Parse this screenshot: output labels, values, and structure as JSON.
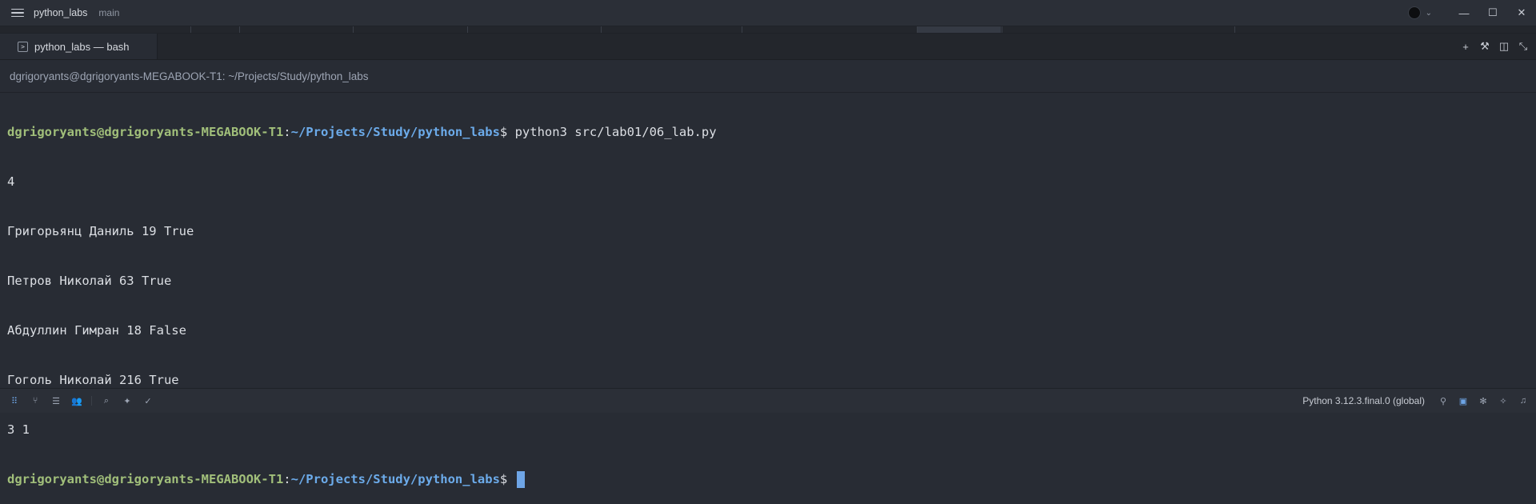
{
  "titlebar": {
    "project": "python_labs",
    "branch": "main"
  },
  "tab": {
    "label": "python_labs — bash",
    "icon": "terminal-icon"
  },
  "path_header": "dgrigoryants@dgrigoryants-MEGABOOK-T1: ~/Projects/Study/python_labs",
  "terminal": {
    "prompt_user": "dgrigoryants@dgrigoryants-MEGABOOK-T1",
    "prompt_colon": ":",
    "prompt_path": "~/Projects/Study/python_labs",
    "prompt_symbol": "$",
    "command": " python3 src/lab01/06_lab.py",
    "output": [
      "4",
      "Григорьянц Даниль 19 True",
      "Петров Николай 63 True",
      "Абдуллин Гимран 18 False",
      "Гоголь Николай 216 True",
      "3 1"
    ]
  },
  "statusbar": {
    "python": "Python 3.12.3.final.0 (global)"
  },
  "colors": {
    "background": "#282c34",
    "prompt_user": "#a1bf7a",
    "prompt_path": "#6cabea",
    "cursor": "#6ea5e6"
  }
}
